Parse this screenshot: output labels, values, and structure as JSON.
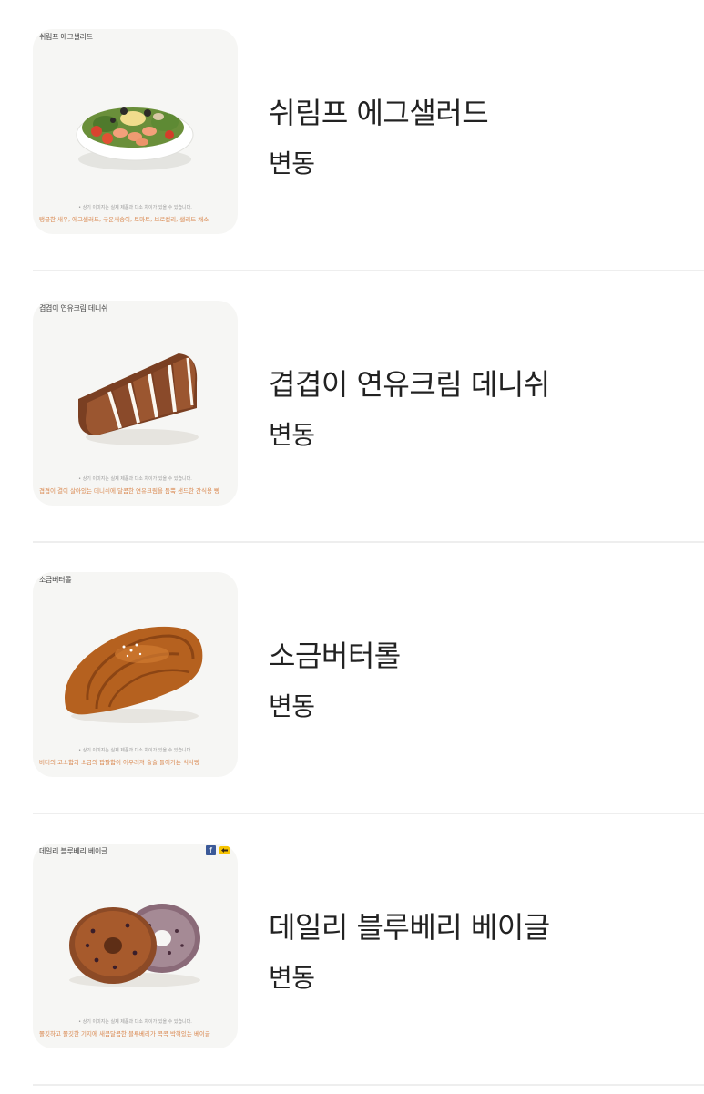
{
  "products": [
    {
      "name": "쉬림프 에그샐러드",
      "price": "변동",
      "thumb_title": "쉬림프 에그샐러드",
      "thumb_note": "• 상기 이미지는 실제 제품과 다소 차이가 있을 수 있습니다.",
      "thumb_desc": "탱글한 새우, 에그샐러드, 구운새송이, 토마토, 브로컬리, 샐러드 채소"
    },
    {
      "name": "겹겹이 연유크림 데니쉬",
      "price": "변동",
      "thumb_title": "겹겹이 연유크림 데니쉬",
      "thumb_note": "• 상기 이미지는 실제 제품과 다소 차이가 있을 수 있습니다.",
      "thumb_desc": "겹겹이 결이 살아있는 데니쉬에 달콤한 연유크림을 듬뿍 샌드한 간식용 빵"
    },
    {
      "name": "소금버터롤",
      "price": "변동",
      "thumb_title": "소금버터롤",
      "thumb_note": "• 상기 이미지는 실제 제품과 다소 차이가 있을 수 있습니다.",
      "thumb_desc": "버터의 고소함과 소금의 짭짤함이 어우러져 술술 들어가는 식사빵"
    },
    {
      "name": "데일리 블루베리 베이글",
      "price": "변동",
      "thumb_title": "데일리 블루베리 베이글",
      "thumb_note": "• 상기 이미지는 실제 제품과 다소 차이가 있을 수 있습니다.",
      "thumb_desc": "쫄깃하고 쫄깃한 기지에 새콤달콤한 블루베리가 콕콕 박혀있는 베이글",
      "share_icons": [
        "facebook-icon",
        "kakaostory-icon"
      ]
    }
  ],
  "colors": {
    "text": "#222222",
    "thumb_bg": "#f6f6f4",
    "desc_orange": "#d9874e",
    "divider": "#eeeeee"
  }
}
